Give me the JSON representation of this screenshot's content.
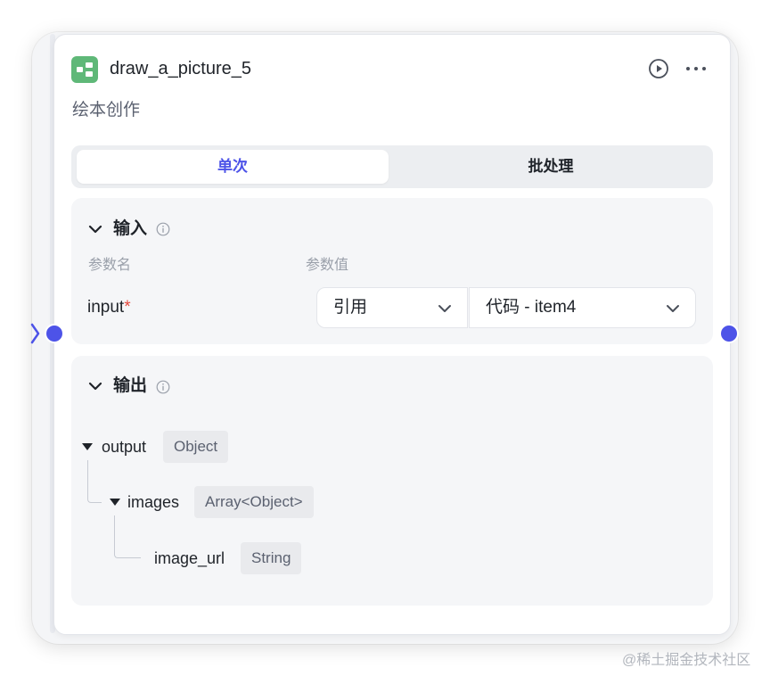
{
  "node": {
    "title": "draw_a_picture_5",
    "description": "绘本创作",
    "header_icon": "workflow-icon",
    "actions": [
      "run-icon",
      "more-icon"
    ]
  },
  "tabs": [
    {
      "label": "单次",
      "active": true
    },
    {
      "label": "批处理",
      "active": false
    }
  ],
  "input_section": {
    "title": "输入",
    "col_name": "参数名",
    "col_value": "参数值",
    "params": [
      {
        "name": "input",
        "required_mark": "*",
        "type": "引用",
        "value": "代码 - item4"
      }
    ]
  },
  "output_section": {
    "title": "输出",
    "fields": [
      {
        "name": "output",
        "type": "Object"
      },
      {
        "name": "images",
        "type": "Array<Object>"
      },
      {
        "name": "image_url",
        "type": "String"
      }
    ]
  },
  "colors": {
    "accent": "#4d53e8",
    "icon_green": "#5fb878",
    "required": "#e5483d"
  },
  "watermark": "@稀土掘金技术社区"
}
